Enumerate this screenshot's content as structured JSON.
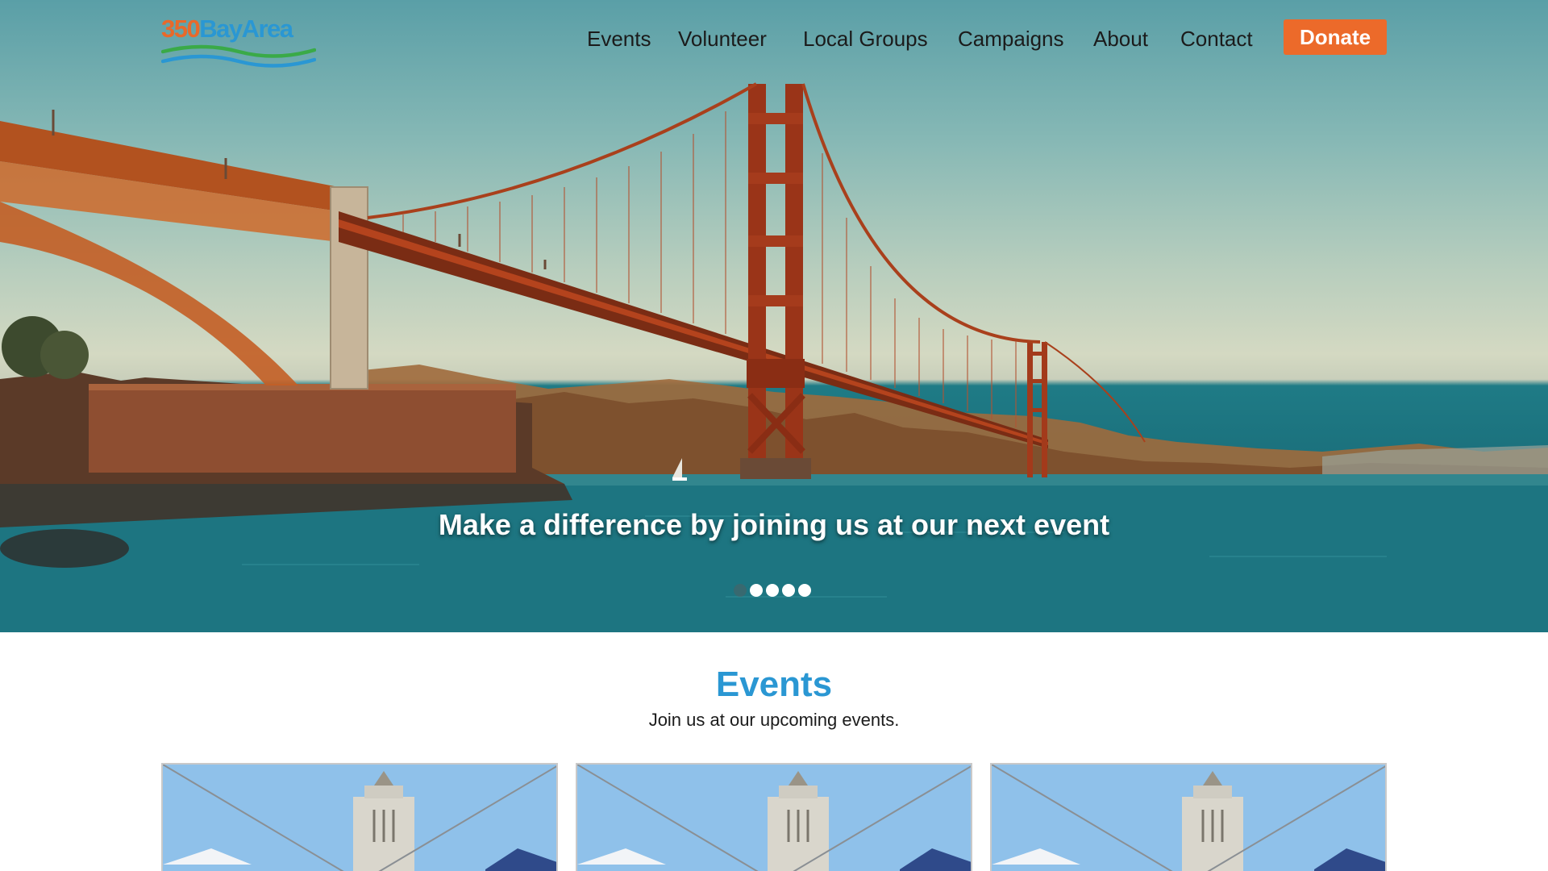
{
  "logo": {
    "prefix": "350",
    "name": "BayArea"
  },
  "nav": {
    "items": [
      {
        "label": "Events"
      },
      {
        "label": "Volunteer"
      },
      {
        "label": "Local Groups"
      },
      {
        "label": "Campaigns"
      },
      {
        "label": "About"
      },
      {
        "label": "Contact"
      }
    ],
    "donate_label": "Donate"
  },
  "hero": {
    "caption": "Make a difference by joining us at our next event",
    "slide_count": 5,
    "active_slide": 1
  },
  "events": {
    "title": "Events",
    "subtitle": "Join us at our upcoming events."
  },
  "colors": {
    "accent_blue": "#2a97d3",
    "donate_orange": "#ec6a2a",
    "logo_green": "#3aaa48"
  }
}
